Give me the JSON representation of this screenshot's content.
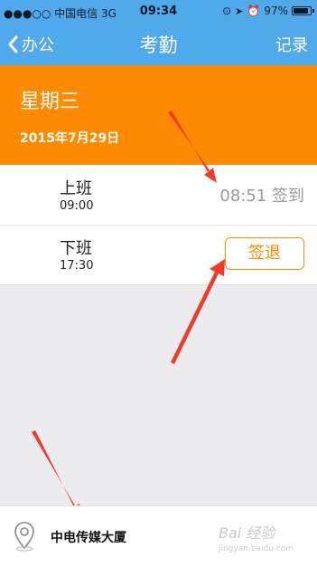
{
  "status_bar": {
    "carrier": "●●●○○ 中国电信  3G",
    "time": "09:34",
    "battery": "97%",
    "battery_level": 0.97
  },
  "nav": {
    "back_label": "办公",
    "title": "考勤",
    "record_label": "记录"
  },
  "day": {
    "weekday": "星期三",
    "date": "2015年7月29日"
  },
  "attendance": {
    "check_in": {
      "label": "上班",
      "time": "09:00",
      "status": "08:51 签到"
    },
    "check_out": {
      "label": "下班",
      "time": "17:30",
      "button": "签退"
    }
  },
  "location": {
    "name": "中电传媒大厦"
  },
  "watermark": {
    "text": "Bai 经验",
    "sub": "jingyan.baidu.com"
  },
  "colors": {
    "nav_bg": "#50a9ea",
    "accent": "#fd8a00",
    "arrow": "#f23a2c"
  }
}
